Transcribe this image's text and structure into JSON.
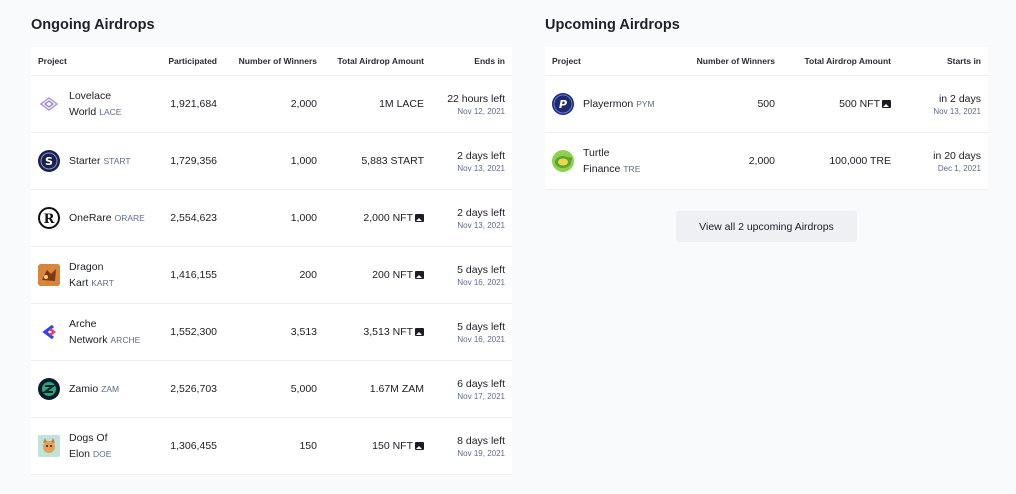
{
  "ongoing": {
    "title": "Ongoing Airdrops",
    "headers": {
      "project": "Project",
      "participated": "Participated",
      "winners": "Number of Winners",
      "amount": "Total Airdrop Amount",
      "ends": "Ends in"
    },
    "rows": [
      {
        "name_line1": "Lovelace",
        "name_line2": "World",
        "symbol": "LACE",
        "participated": "1,921,684",
        "winners": "2,000",
        "amount": "1M LACE",
        "ends": "22 hours left",
        "date": "Nov 12, 2021",
        "icon": "lovelace-logo",
        "color": "#ffffff"
      },
      {
        "name_line1": "Starter",
        "name_line2": "",
        "symbol": "START",
        "participated": "1,729,356",
        "winners": "1,000",
        "amount": "5,883 START",
        "ends": "2 days left",
        "date": "Nov 13, 2021",
        "icon": "starter-logo",
        "color": "#1c2341"
      },
      {
        "name_line1": "OneRare",
        "name_line2": "",
        "symbol": "ORARE",
        "participated": "2,554,623",
        "winners": "1,000",
        "amount": "2,000 NFT",
        "ends": "2 days left",
        "date": "Nov 13, 2021",
        "icon": "onerare-logo",
        "color": "#ffffff"
      },
      {
        "name_line1": "Dragon",
        "name_line2": "Kart",
        "symbol": "KART",
        "participated": "1,416,155",
        "winners": "200",
        "amount": "200 NFT",
        "ends": "5 days left",
        "date": "Nov 16, 2021",
        "icon": "dragon-kart-logo",
        "color": "#c2622c"
      },
      {
        "name_line1": "Arche",
        "name_line2": "Network",
        "symbol": "ARCHE",
        "participated": "1,552,300",
        "winners": "3,513",
        "amount": "3,513 NFT",
        "ends": "5 days left",
        "date": "Nov 16, 2021",
        "icon": "arche-logo",
        "color": "#ffffff"
      },
      {
        "name_line1": "Zamio",
        "name_line2": "",
        "symbol": "ZAM",
        "participated": "2,526,703",
        "winners": "5,000",
        "amount": "1.67M ZAM",
        "ends": "6 days left",
        "date": "Nov 17, 2021",
        "icon": "zamio-logo",
        "color": "#0c1b2e"
      },
      {
        "name_line1": "Dogs Of",
        "name_line2": "Elon",
        "symbol": "DOE",
        "participated": "1,306,455",
        "winners": "150",
        "amount": "150 NFT",
        "ends": "8 days left",
        "date": "Nov 19, 2021",
        "icon": "dogs-of-elon-logo",
        "color": "#bfe3dc"
      }
    ]
  },
  "upcoming": {
    "title": "Upcoming Airdrops",
    "headers": {
      "project": "Project",
      "winners": "Number of Winners",
      "amount": "Total Airdrop Amount",
      "starts": "Starts in"
    },
    "rows": [
      {
        "name_line1": "Playermon",
        "name_line2": "",
        "symbol": "PYM",
        "winners": "500",
        "amount": "500 NFT",
        "starts": "in 2 days",
        "date": "Nov 13, 2021",
        "icon": "playermon-logo",
        "color": "#1d2a6b"
      },
      {
        "name_line1": "Turtle",
        "name_line2": "Finance",
        "symbol": "TRE",
        "winners": "2,000",
        "amount": "100,000 TRE",
        "starts": "in 20 days",
        "date": "Dec 1, 2021",
        "icon": "turtle-finance-logo",
        "color": "#8fd14f"
      }
    ],
    "view_all_label": "View all 2 upcoming Airdrops"
  }
}
